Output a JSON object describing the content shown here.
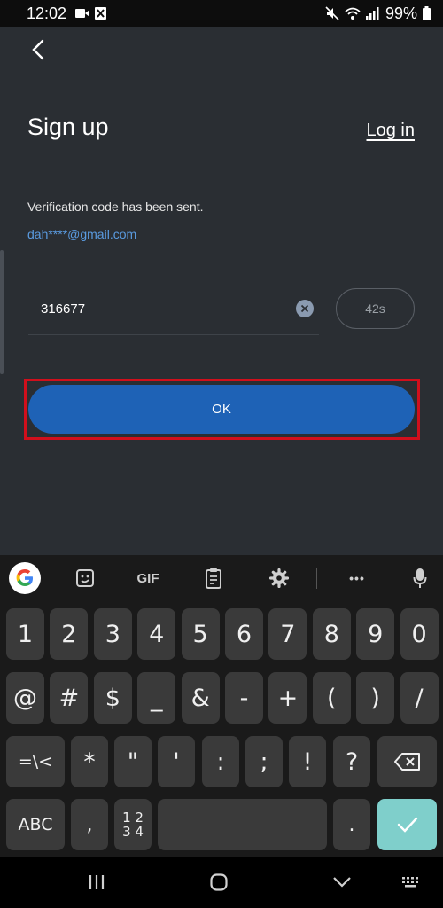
{
  "status_bar": {
    "time": "12:02",
    "battery": "99%"
  },
  "screen": {
    "title": "Sign up",
    "login_link": "Log in",
    "message": "Verification code has been sent.",
    "email": "dah****@gmail.com",
    "code_value": "316677",
    "timer": "42s",
    "ok_label": "OK"
  },
  "keyboard": {
    "toolbar": {
      "gif_label": "GIF",
      "more_label": "•••"
    },
    "row1": [
      "1",
      "2",
      "3",
      "4",
      "5",
      "6",
      "7",
      "8",
      "9",
      "0"
    ],
    "row2": [
      "@",
      "#",
      "$",
      "_",
      "&",
      "-",
      "+",
      "(",
      ")",
      "/"
    ],
    "row3": [
      "=\\<",
      "*",
      "\"",
      "'",
      ":",
      ";",
      "!",
      "?"
    ],
    "abc_label": "ABC",
    "comma": ",",
    "num_top": "1 2",
    "num_bottom": "3 4",
    "period": "."
  },
  "colors": {
    "accent": "#1e62b6",
    "link": "#5a9be0",
    "highlight": "#d10f1c",
    "done_key": "#7fcfcb"
  }
}
